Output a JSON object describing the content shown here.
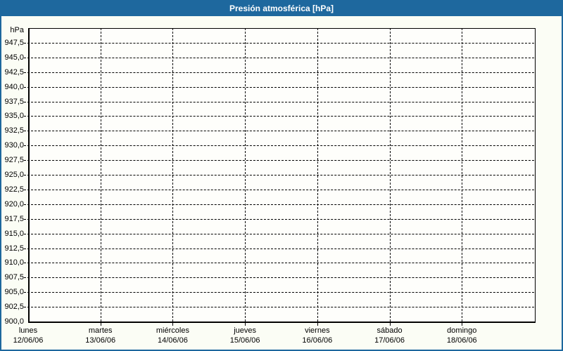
{
  "window": {
    "title": "Presión atmosférica [hPa]"
  },
  "colors": {
    "frame_border": "#1e689e",
    "titlebar_bg": "#1e689e",
    "titlebar_text": "#ffffff",
    "page_bg": "#fbfdf5",
    "plot_bg": "#fefefb",
    "grid": "#000000",
    "label_text": "#000000"
  },
  "chart_data": {
    "type": "line",
    "title": "Presión atmosférica [hPa]",
    "ylabel": "hPa",
    "xlabel": "",
    "ylim": [
      900,
      950
    ],
    "y_tick_step": 2.5,
    "grid": "dashed",
    "legend": "none",
    "series": [],
    "y_ticks": [
      {
        "label": "947,5",
        "value": 947.5
      },
      {
        "label": "945,0",
        "value": 945.0
      },
      {
        "label": "942,5",
        "value": 942.5
      },
      {
        "label": "940,0",
        "value": 940.0
      },
      {
        "label": "937,5",
        "value": 937.5
      },
      {
        "label": "935,0",
        "value": 935.0
      },
      {
        "label": "932,5",
        "value": 932.5
      },
      {
        "label": "930,0",
        "value": 930.0
      },
      {
        "label": "927,5",
        "value": 927.5
      },
      {
        "label": "925,0",
        "value": 925.0
      },
      {
        "label": "922,5",
        "value": 922.5
      },
      {
        "label": "920,0",
        "value": 920.0
      },
      {
        "label": "917,5",
        "value": 917.5
      },
      {
        "label": "915,0",
        "value": 915.0
      },
      {
        "label": "912,5",
        "value": 912.5
      },
      {
        "label": "910,0",
        "value": 910.0
      },
      {
        "label": "907,5",
        "value": 907.5
      },
      {
        "label": "905,0",
        "value": 905.0
      },
      {
        "label": "902,5",
        "value": 902.5
      },
      {
        "label": "900,0",
        "value": 900.0
      }
    ],
    "x_categories": [
      {
        "day": "lunes",
        "date": "12/06/06"
      },
      {
        "day": "martes",
        "date": "13/06/06"
      },
      {
        "day": "miércoles",
        "date": "14/06/06"
      },
      {
        "day": "jueves",
        "date": "15/06/06"
      },
      {
        "day": "viernes",
        "date": "16/06/06"
      },
      {
        "day": "sábado",
        "date": "17/06/06"
      },
      {
        "day": "domingo",
        "date": "18/06/06"
      }
    ]
  }
}
